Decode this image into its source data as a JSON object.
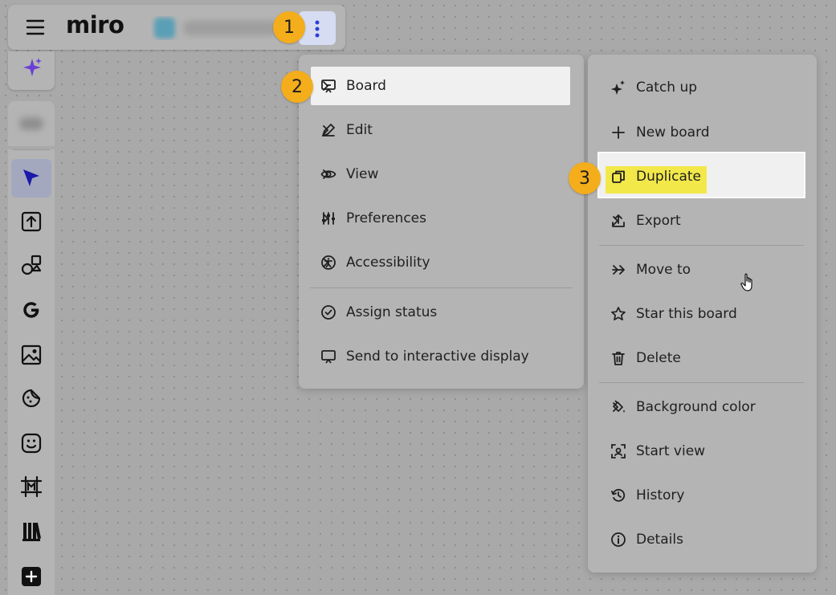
{
  "app": {
    "logo": "miro"
  },
  "header": {
    "menu_icon": "hamburger-icon",
    "more_icon": "vertical-ellipsis-icon"
  },
  "callouts": [
    "1",
    "2",
    "3"
  ],
  "toolbar": {
    "ai_icon": "sparkle-icon",
    "tools": [
      {
        "icon": "select-cursor-icon",
        "active": true
      },
      {
        "icon": "upload-icon"
      },
      {
        "icon": "shapes-icon"
      },
      {
        "icon": "google-icon"
      },
      {
        "icon": "image-icon"
      },
      {
        "icon": "sticker-icon"
      },
      {
        "icon": "emoji-icon"
      },
      {
        "icon": "frame-icon"
      },
      {
        "icon": "library-icon"
      },
      {
        "icon": "add-icon"
      }
    ]
  },
  "main_menu": {
    "items": [
      {
        "label": "Board",
        "icon": "board-icon",
        "submenu": true,
        "highlighted": true
      },
      {
        "label": "Edit",
        "icon": "pen-icon",
        "submenu": true
      },
      {
        "label": "View",
        "icon": "eye-icon",
        "submenu": true
      },
      {
        "label": "Preferences",
        "icon": "sliders-icon",
        "submenu": true
      },
      {
        "label": "Accessibility",
        "icon": "accessibility-icon",
        "submenu": true
      },
      {
        "label": "Assign status",
        "icon": "check-circle-icon"
      },
      {
        "label": "Send to interactive display",
        "icon": "display-icon"
      }
    ]
  },
  "board_submenu": {
    "items": [
      {
        "label": "Catch up",
        "icon": "sparkle-icon"
      },
      {
        "label": "New board",
        "icon": "plus-icon"
      },
      {
        "label": "Duplicate",
        "icon": "duplicate-icon",
        "highlighted": true
      },
      {
        "label": "Export",
        "icon": "export-icon",
        "submenu": true
      },
      {
        "label": "Move to",
        "icon": "arrow-right-icon",
        "submenu": true
      },
      {
        "label": "Star this board",
        "icon": "star-icon"
      },
      {
        "label": "Delete",
        "icon": "trash-icon"
      },
      {
        "label": "Background color",
        "icon": "paint-bucket-icon",
        "submenu": true
      },
      {
        "label": "Start view",
        "icon": "start-view-icon"
      },
      {
        "label": "History",
        "icon": "history-icon"
      },
      {
        "label": "Details",
        "icon": "info-icon"
      }
    ]
  },
  "colors": {
    "callout": "#f4ad1b",
    "highlight_yellow": "#f2e84a",
    "active_tool": "#1a1aa8"
  }
}
